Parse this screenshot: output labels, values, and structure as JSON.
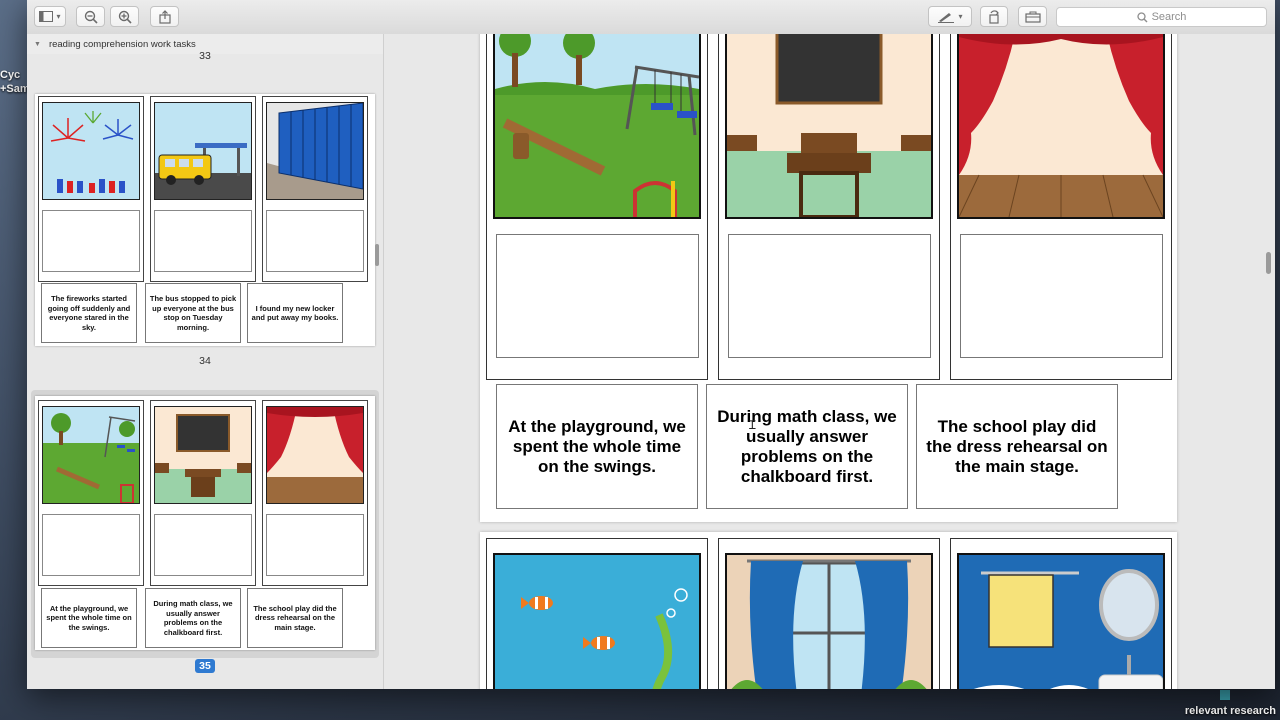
{
  "desktop": {
    "left_text_line1": "Cyc",
    "left_text_line2": "+Sam",
    "bottom_right_text": "relevant research"
  },
  "toolbar": {
    "search_placeholder": "Search"
  },
  "sidebar": {
    "outline_title": "reading comprehension work tasks",
    "pages": [
      {
        "number_above": "33",
        "captions": [
          "The fireworks started going off suddenly and everyone stared in the sky.",
          "The bus stopped to pick up everyone at the bus stop on Tuesday morning.",
          "I found my new locker and put away my books."
        ]
      },
      {
        "number_above": "34",
        "captions": [
          "At the playground, we spent the whole time on the swings.",
          "During math class, we usually answer problems on the chalkboard first.",
          "The school play did the dress rehearsal on the main stage."
        ]
      }
    ],
    "selected_page_number": "35"
  },
  "main": {
    "captions": [
      "At the playground, we spent the whole time on the swings.",
      "During math class, we usually answer problems on the chalkboard first.",
      "The school play did the dress rehearsal on the main stage."
    ]
  },
  "colors": {
    "accent": "#2f7ad1",
    "sky": "#bfe4f3",
    "grass": "#5da832",
    "ocean": "#3aaed8",
    "curtain": "#c8202c",
    "floor": "#9c6a3c",
    "bathroom": "#1f6bb5"
  }
}
